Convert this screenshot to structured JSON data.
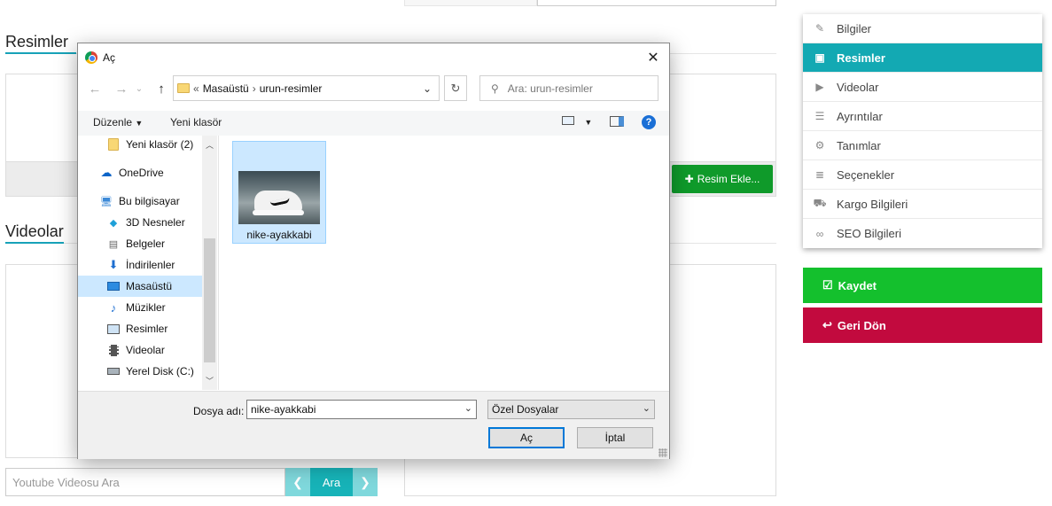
{
  "page": {
    "resimler_title": "Resimler",
    "videolar_title": "Videolar",
    "add_image_label": "Resim Ekle...",
    "youtube_placeholder": "Youtube Videosu Ara",
    "search_button": "Ara",
    "accent_color": "#17a2b8"
  },
  "side_menu": {
    "items": [
      {
        "label": "Bilgiler",
        "icon": "edit-icon"
      },
      {
        "label": "Resimler",
        "icon": "image-icon",
        "active": true
      },
      {
        "label": "Videolar",
        "icon": "youtube-icon"
      },
      {
        "label": "Ayrıntılar",
        "icon": "list-icon"
      },
      {
        "label": "Tanımlar",
        "icon": "gears-icon"
      },
      {
        "label": "Seçenekler",
        "icon": "database-icon"
      },
      {
        "label": "Kargo Bilgileri",
        "icon": "truck-icon"
      },
      {
        "label": "SEO Bilgileri",
        "icon": "link-icon"
      }
    ],
    "save_label": "Kaydet",
    "back_label": "Geri Dön",
    "save_color": "#14c02d",
    "back_color": "#c20a3e"
  },
  "dialog": {
    "title": "Aç",
    "path_prefix": "«",
    "path": [
      "Masaüstü",
      "urun-resimler"
    ],
    "search_placeholder": "Ara: urun-resimler",
    "organize_label": "Düzenle",
    "new_folder_label": "Yeni klasör",
    "nav_items": [
      {
        "label": "Yeni klasör (2)",
        "icon": "folder-icon"
      },
      {
        "label": "OneDrive",
        "icon": "cloud-icon"
      },
      {
        "label": "Bu bilgisayar",
        "icon": "computer-icon"
      },
      {
        "label": "3D Nesneler",
        "icon": "cube-icon"
      },
      {
        "label": "Belgeler",
        "icon": "document-icon"
      },
      {
        "label": "İndirilenler",
        "icon": "download-icon"
      },
      {
        "label": "Masaüstü",
        "icon": "desktop-icon",
        "selected": true
      },
      {
        "label": "Müzikler",
        "icon": "music-icon"
      },
      {
        "label": "Resimler",
        "icon": "pictures-icon"
      },
      {
        "label": "Videolar",
        "icon": "film-icon"
      },
      {
        "label": "Yerel Disk (C:)",
        "icon": "drive-icon"
      }
    ],
    "files": [
      {
        "name": "nike-ayakkabi",
        "selected": true
      }
    ],
    "filename_label": "Dosya adı:",
    "filename_value": "nike-ayakkabi",
    "filter_value": "Özel Dosyalar",
    "open_label": "Aç",
    "cancel_label": "İptal"
  }
}
